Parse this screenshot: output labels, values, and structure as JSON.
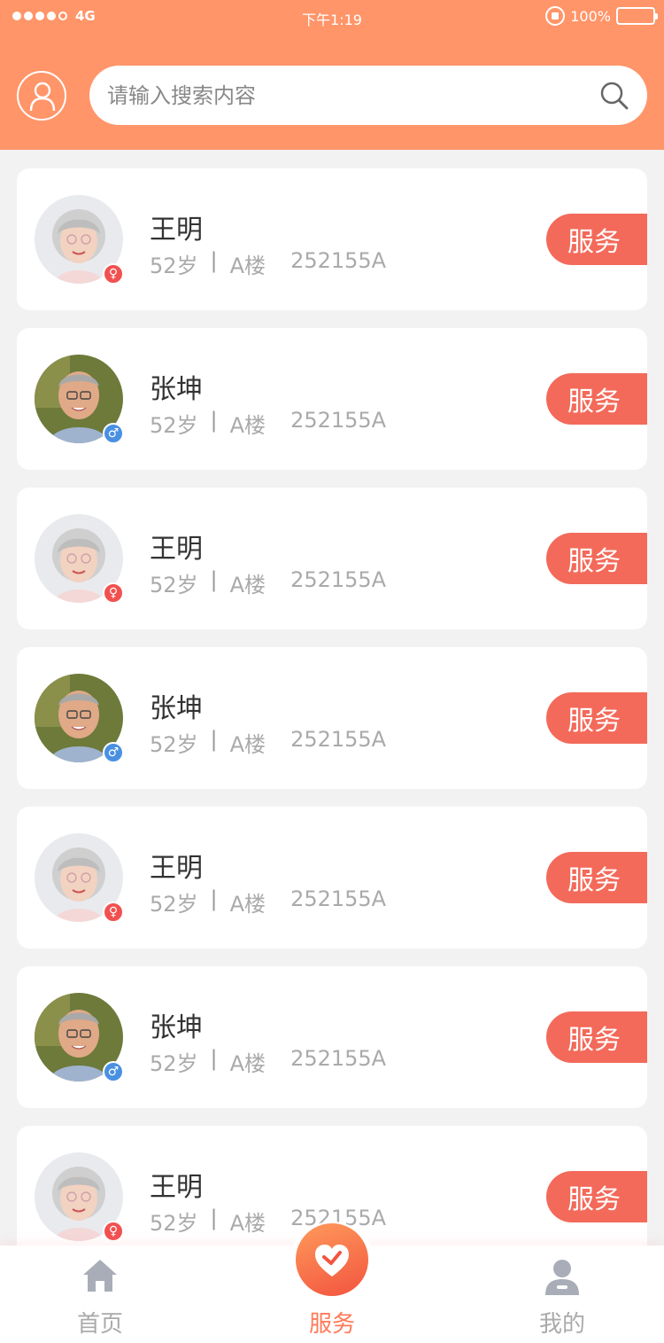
{
  "status_bar": {
    "network": "4G",
    "time": "下午1:19",
    "battery_text": "100%"
  },
  "header": {
    "profile_icon": "user-icon",
    "search": {
      "placeholder": "请输入搜索内容",
      "value": "",
      "icon": "search-icon"
    }
  },
  "colors": {
    "header_bg": "#ff9569",
    "service_button": "#f36a5a",
    "female_badge": "#f25050",
    "male_badge": "#4a90e2",
    "tab_active": "#ff7a59"
  },
  "residents": [
    {
      "name": "王明",
      "age": "52岁",
      "building": "A楼",
      "room": "252155A",
      "gender": "female",
      "gender_symbol": "♀",
      "action": "服务"
    },
    {
      "name": "张坤",
      "age": "52岁",
      "building": "A楼",
      "room": "252155A",
      "gender": "male",
      "gender_symbol": "♂",
      "action": "服务"
    },
    {
      "name": "王明",
      "age": "52岁",
      "building": "A楼",
      "room": "252155A",
      "gender": "female",
      "gender_symbol": "♀",
      "action": "服务"
    },
    {
      "name": "张坤",
      "age": "52岁",
      "building": "A楼",
      "room": "252155A",
      "gender": "male",
      "gender_symbol": "♂",
      "action": "服务"
    },
    {
      "name": "王明",
      "age": "52岁",
      "building": "A楼",
      "room": "252155A",
      "gender": "female",
      "gender_symbol": "♀",
      "action": "服务"
    },
    {
      "name": "张坤",
      "age": "52岁",
      "building": "A楼",
      "room": "252155A",
      "gender": "male",
      "gender_symbol": "♂",
      "action": "服务"
    },
    {
      "name": "王明",
      "age": "52岁",
      "building": "A楼",
      "room": "252155A",
      "gender": "female",
      "gender_symbol": "♀",
      "action": "服务"
    }
  ],
  "separator": "|",
  "tabbar": {
    "tabs": [
      {
        "label": "首页",
        "icon": "home-icon",
        "active": false
      },
      {
        "label": "服务",
        "icon": "heart-icon",
        "active": true
      },
      {
        "label": "我的",
        "icon": "profile-icon",
        "active": false
      }
    ]
  }
}
